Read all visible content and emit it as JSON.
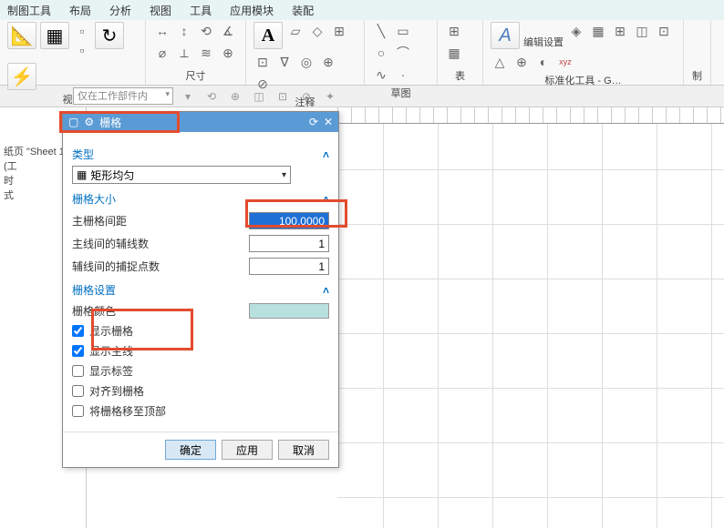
{
  "menu": {
    "items": [
      "制图工具",
      "布局",
      "分析",
      "视图",
      "工具",
      "应用模块",
      "装配"
    ]
  },
  "ribbon": {
    "groups": [
      {
        "label": "视图",
        "items": [
          "向导",
          "基本视图",
          "",
          "更新视图",
          "快速"
        ]
      },
      {
        "label": "尺寸"
      },
      {
        "label": "注释"
      },
      {
        "label": "草图"
      },
      {
        "label": "表"
      },
      {
        "label": "标准化工具 - G…",
        "extra": "编辑设置"
      },
      {
        "label": "制"
      }
    ]
  },
  "context": {
    "scope": "仅在工作部件内"
  },
  "sidebar": {
    "line1": "纸页 \"Sheet 1\" (工",
    "line2": "时",
    "line3": "式"
  },
  "dialog": {
    "title": "栅格",
    "sections": {
      "type": {
        "header": "类型",
        "select": "矩形均匀"
      },
      "size": {
        "header": "栅格大小",
        "rows": [
          {
            "label": "主栅格间距",
            "value": "100.0000"
          },
          {
            "label": "主线间的辅线数",
            "value": "1"
          },
          {
            "label": "辅线间的捕捉点数",
            "value": "1"
          }
        ]
      },
      "settings": {
        "header": "栅格设置",
        "color_label": "栅格颜色",
        "checks": [
          {
            "label": "显示栅格",
            "checked": true
          },
          {
            "label": "显示主线",
            "checked": true
          },
          {
            "label": "显示标签",
            "checked": false
          },
          {
            "label": "对齐到栅格",
            "checked": false
          },
          {
            "label": "将栅格移至顶部",
            "checked": false
          }
        ]
      }
    },
    "buttons": {
      "ok": "确定",
      "apply": "应用",
      "cancel": "取消"
    }
  }
}
